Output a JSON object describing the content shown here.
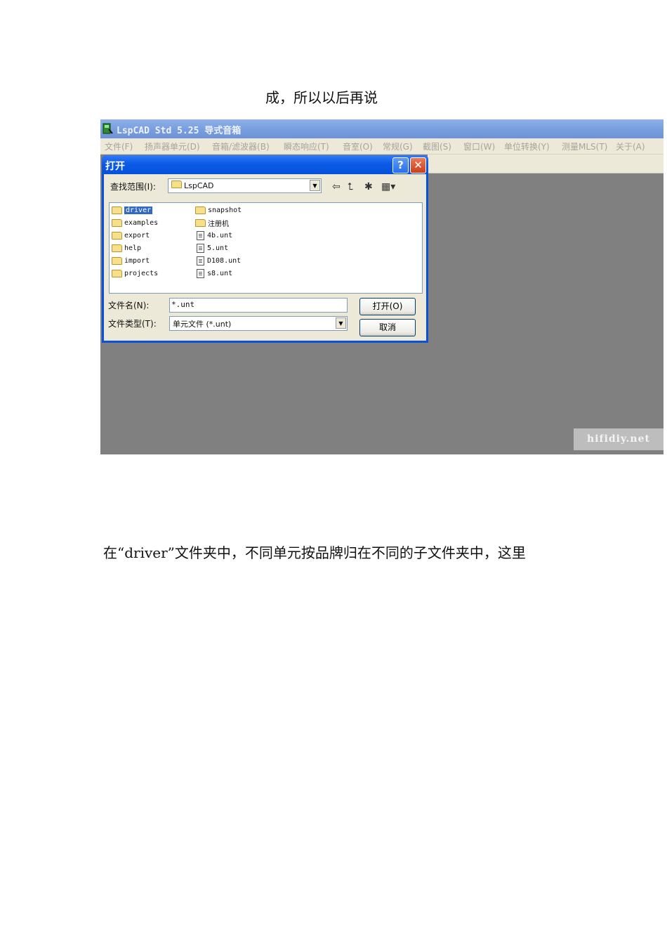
{
  "document": {
    "para_top": "成，所以以后再说",
    "para_bottom": "在“driver”文件夹中，不同单元按品牌归在不同的子文件夹中，这里"
  },
  "app": {
    "title": "LspCAD Std 5.25 导式音箱",
    "menu": [
      "文件(F)",
      "扬声器单元(D)",
      "音箱/滤波器(B)",
      "瞬态响应(T)",
      "音室(O)",
      "常规(G)",
      "截图(S)",
      "窗口(W)",
      "单位转换(Y)",
      "测量MLS(T)",
      "关于(A)"
    ]
  },
  "dialog": {
    "title": "打开",
    "help_label": "?",
    "close_label": "✕",
    "lookin_label": "查找范围(I):",
    "lookin_value": "LspCAD",
    "files_col1": [
      "driver",
      "examples",
      "export",
      "help",
      "import",
      "projects"
    ],
    "files_col2": [
      "snapshot",
      "注册机",
      "4b.unt",
      "5.unt",
      "D108.unt",
      "s8.unt"
    ],
    "filename_label": "文件名(N):",
    "filename_value": "*.unt",
    "filetype_label": "文件类型(T):",
    "filetype_value": "单元文件 (*.unt)",
    "open_button": "打开(O)",
    "cancel_button": "取消"
  },
  "watermark": "hifidiy.net"
}
